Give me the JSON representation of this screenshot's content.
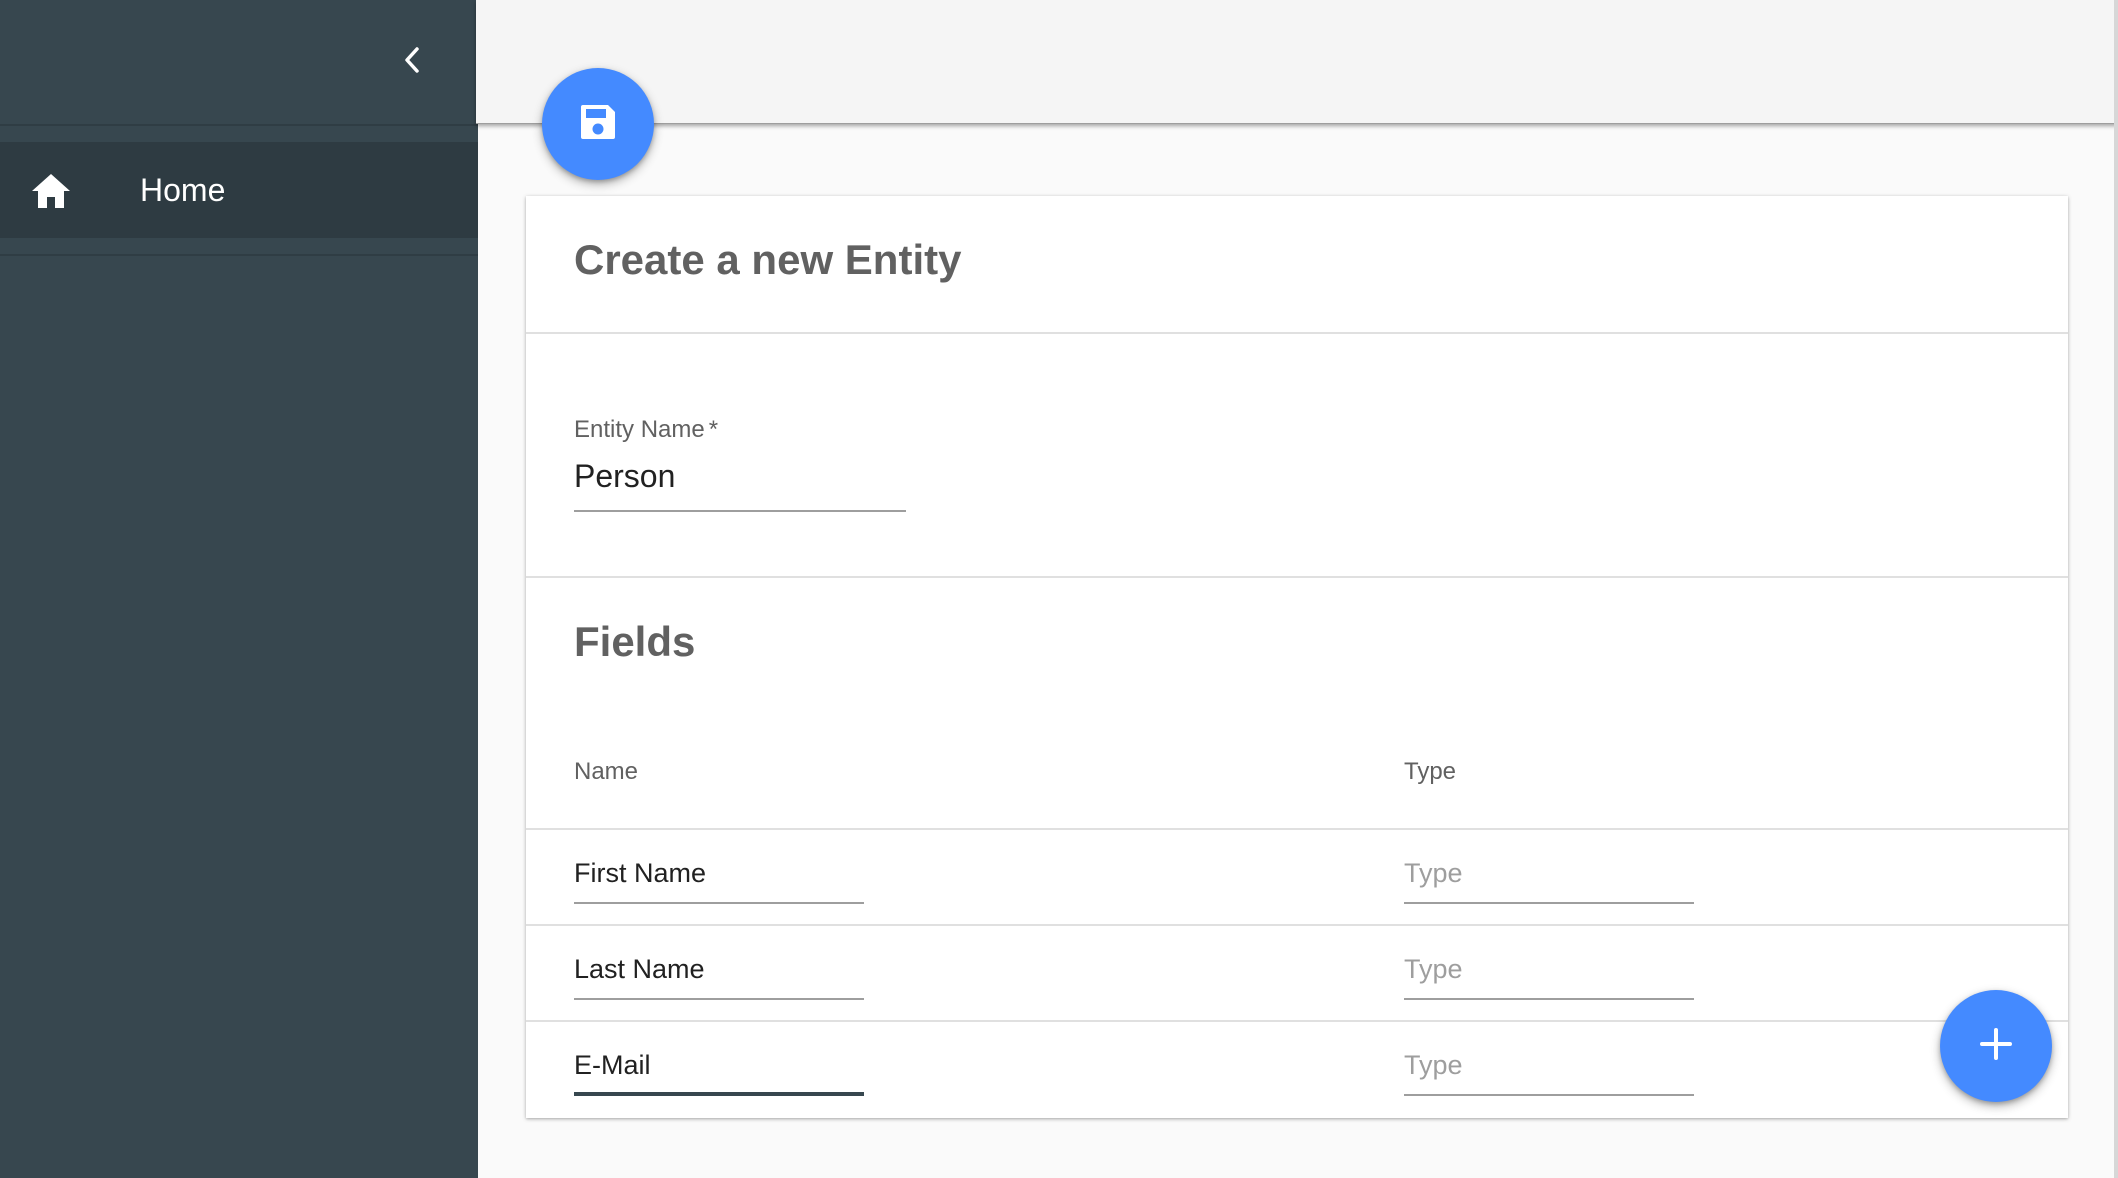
{
  "sidebar": {
    "collapse_icon": "chevron-left-icon",
    "items": [
      {
        "label": "Home",
        "icon": "home-icon"
      }
    ]
  },
  "toolbar": {
    "save_icon": "save-icon"
  },
  "form": {
    "title": "Create a new Entity",
    "entity_name": {
      "label": "Entity Name",
      "required_mark": "*",
      "value": "Person"
    }
  },
  "fields": {
    "title": "Fields",
    "columns": {
      "name": "Name",
      "type": "Type"
    },
    "rows": [
      {
        "name": "First Name",
        "type_placeholder": "Type"
      },
      {
        "name": "Last Name",
        "type_placeholder": "Type"
      },
      {
        "name": "E-Mail",
        "type_placeholder": "Type"
      }
    ]
  },
  "add_button": {
    "icon": "plus-icon"
  },
  "colors": {
    "sidebar_bg": "#37474f",
    "sidebar_active_bg": "#2e3b42",
    "accent": "#448aff",
    "topbar_bg": "#f5f5f5"
  }
}
